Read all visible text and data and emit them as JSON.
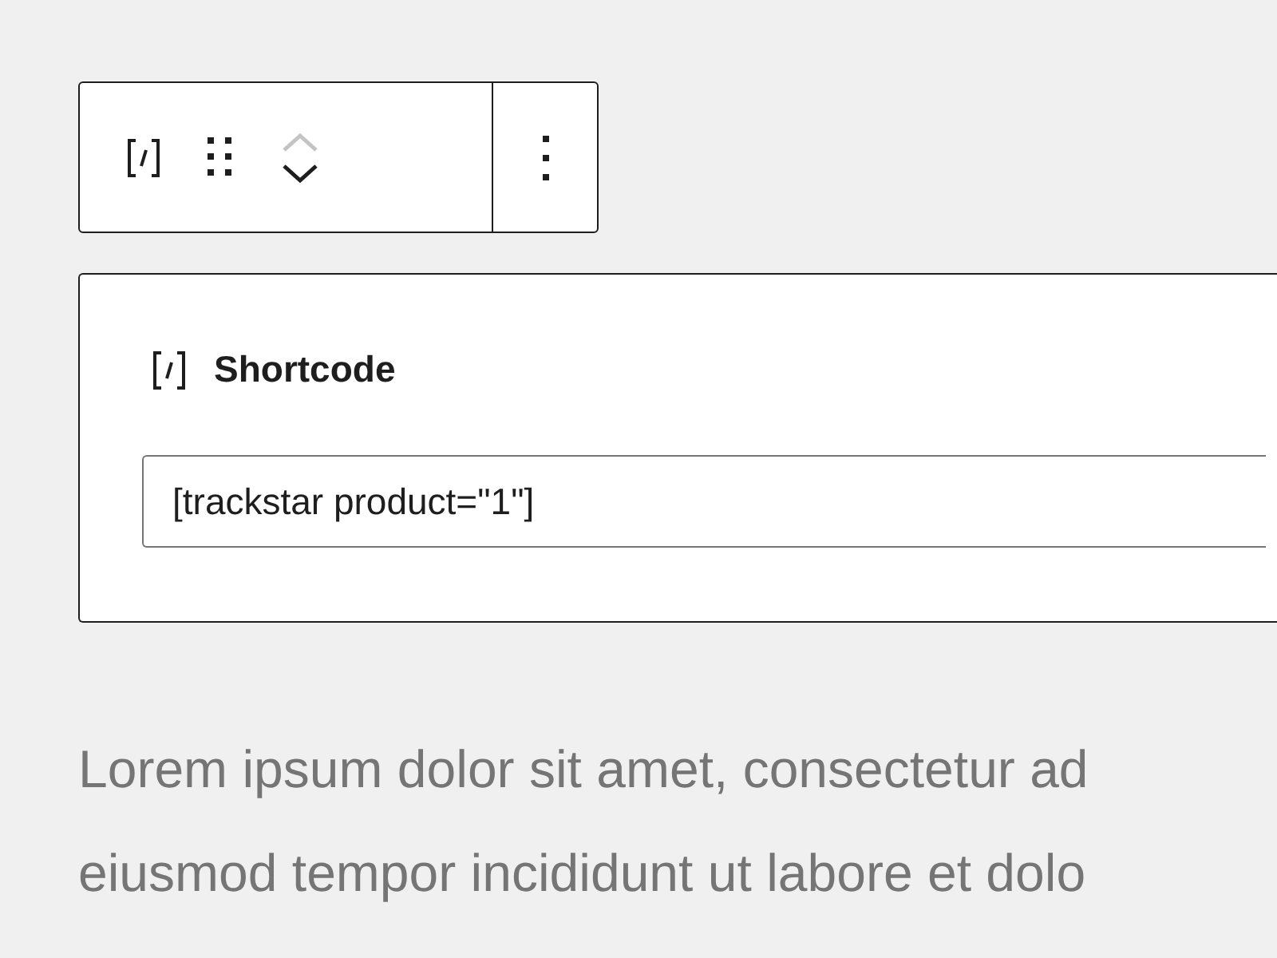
{
  "toolbar": {
    "move_up": {
      "disabled": true
    },
    "move_down": {
      "disabled": false
    }
  },
  "shortcode_block": {
    "title": "Shortcode",
    "value": "[trackstar product=\"1\"]"
  },
  "paragraph": [
    "Lorem ipsum dolor sit amet, consectetur ad",
    "eiusmod tempor incididunt ut labore et dolo"
  ]
}
